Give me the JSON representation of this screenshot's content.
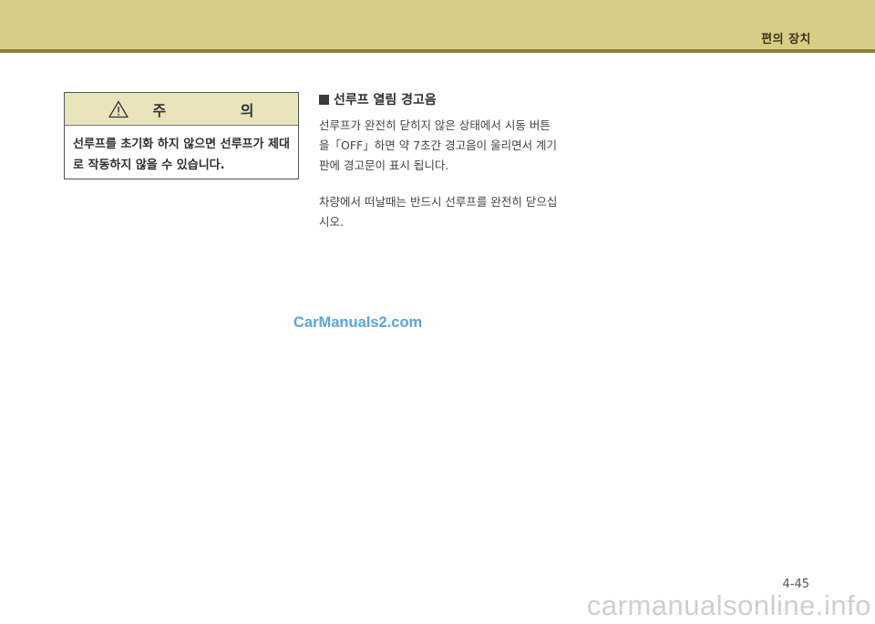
{
  "header": {
    "section_title": "편의 장치"
  },
  "caution": {
    "icon": "warning-triangle-icon",
    "title": "주 의",
    "body": "선루프를 초기화 하지 않으면 선루프가 제대로 작동하지 않을 수 있습니다."
  },
  "section": {
    "heading": "선루프 열림 경고음",
    "paragraphs": [
      "선루프가 완전히 닫히지 않은 상태에서 시동 버튼을「OFF」하면 약 7초간 경고음이 울리면서 계기판에 경고문이 표시 됩니다.",
      "차량에서 떠날때는 반드시 선루프를 완전히 닫으십시오."
    ]
  },
  "watermark": "CarManuals2.com",
  "page_number": "4-45",
  "footer_watermark": "carmanualsonline.info"
}
